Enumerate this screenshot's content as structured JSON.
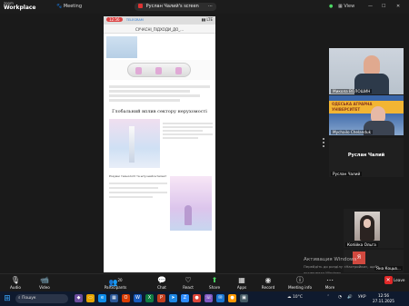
{
  "app": {
    "brand_small": "zoom",
    "brand": "Workplace",
    "meeting_label": "Meeting"
  },
  "share_banner": {
    "text": "Руслан Чалий's screen"
  },
  "top_right": {
    "view_label": "View"
  },
  "shared_screen": {
    "phone_time": "12:56",
    "phone_app": "TELEGRAM",
    "doc_title": "СУЧАСНІ_ПІДХОДИ_ДО_...",
    "section_heading": "Глобальний вплив сектору нерухомості",
    "section2_heading": "Розумні технології та штучний інтелект"
  },
  "participants": [
    {
      "name": "Микола ВОЛОШИН"
    },
    {
      "name": "Mychailo Chelanduk"
    },
    {
      "name": "Руслан Чалий",
      "center_label": "Руслан Чалий"
    },
    {
      "name": "Копійка Ольга"
    },
    {
      "name": "Яна Коцьв...",
      "initial": "Я"
    }
  ],
  "banner_text": "ОДЕСЬКА АГРАРНА УНІВЕРСИТЕТ",
  "activate_windows": {
    "title": "Активация Windows",
    "sub1": "Перейдіть до розділу «Настройки», щоб",
    "sub2": "активувати Windows."
  },
  "toolbar": {
    "audio": "Audio",
    "video": "Video",
    "participants": "Participants",
    "participants_count": "20",
    "chat": "Chat",
    "react": "React",
    "share": "Share",
    "apps": "Apps",
    "record": "Record",
    "meeting_info": "Meeting info",
    "more": "More",
    "leave": "Leave"
  },
  "taskbar": {
    "search": "Пошук",
    "weather": "10°C",
    "lang": "УКР",
    "time": "12:56",
    "date": "27.11.2025"
  },
  "colors": {
    "zoom_bg": "#1a1a1a",
    "share_green": "#4cd964",
    "leave_red": "#e02828"
  }
}
